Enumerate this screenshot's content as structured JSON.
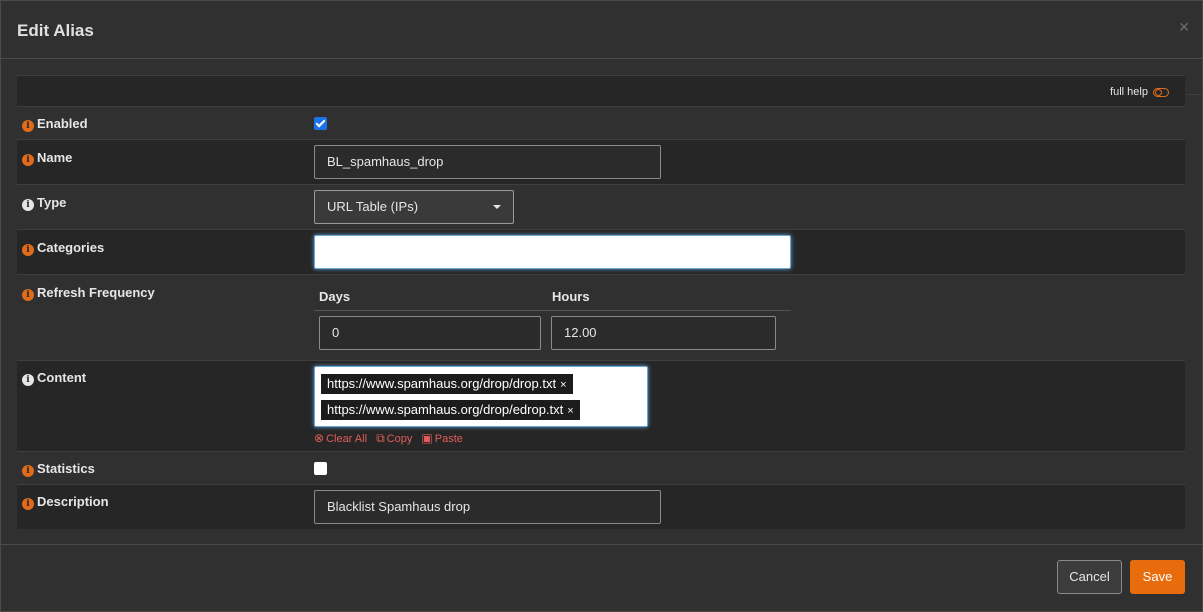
{
  "modal": {
    "title": "Edit Alias",
    "close_glyph": "✕",
    "full_help_label": "full help"
  },
  "fields": {
    "enabled": {
      "label": "Enabled",
      "checked": true
    },
    "name": {
      "label": "Name",
      "value": "BL_spamhaus_drop"
    },
    "type": {
      "label": "Type",
      "value": "URL Table (IPs)"
    },
    "categories": {
      "label": "Categories",
      "value": ""
    },
    "refresh": {
      "label": "Refresh Frequency",
      "days_label": "Days",
      "hours_label": "Hours",
      "days_value": "0",
      "hours_value": "12.00"
    },
    "content": {
      "label": "Content",
      "tags": [
        "https://www.spamhaus.org/drop/drop.txt",
        "https://www.spamhaus.org/drop/edrop.txt"
      ],
      "tag_remove_glyph": "×",
      "clear_all": "Clear All",
      "copy": "Copy",
      "paste": "Paste"
    },
    "statistics": {
      "label": "Statistics",
      "checked": false
    },
    "description": {
      "label": "Description",
      "value": "Blacklist Spamhaus drop"
    }
  },
  "footer": {
    "cancel_label": "Cancel",
    "save_label": "Save"
  },
  "icons": {
    "info": "info-icon",
    "toggle": "toggle-icon",
    "clear": "times-circle-icon",
    "copy": "copy-icon",
    "paste": "paste-icon"
  },
  "colors": {
    "accent": "#e86c0c",
    "checkbox": "#1a73e8",
    "link": "#e05d5d"
  }
}
